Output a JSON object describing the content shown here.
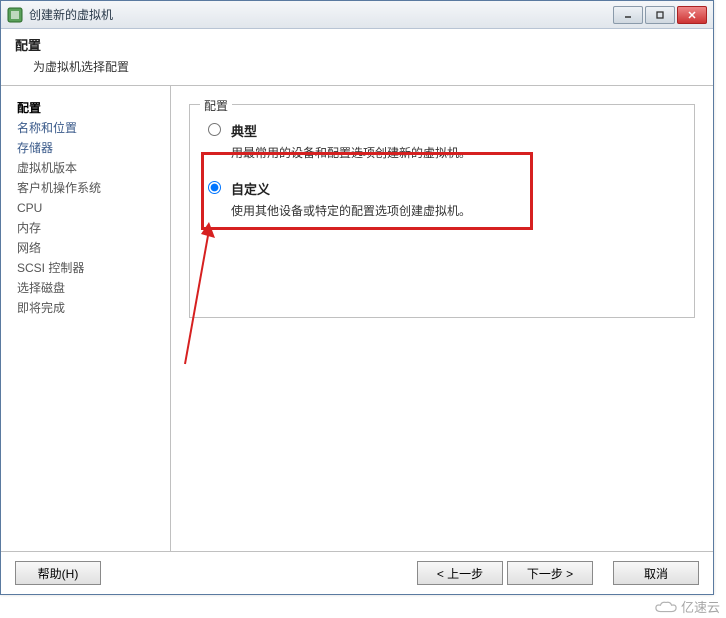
{
  "window": {
    "title": "创建新的虚拟机"
  },
  "header": {
    "title": "配置",
    "subtitle": "为虚拟机选择配置"
  },
  "sidebar": {
    "items": [
      {
        "label": "配置",
        "kind": "current"
      },
      {
        "label": "名称和位置",
        "kind": "link"
      },
      {
        "label": "存储器",
        "kind": "link"
      },
      {
        "label": "虚拟机版本",
        "kind": "text"
      },
      {
        "label": "客户机操作系统",
        "kind": "text"
      },
      {
        "label": "CPU",
        "kind": "text"
      },
      {
        "label": "内存",
        "kind": "text"
      },
      {
        "label": "网络",
        "kind": "text"
      },
      {
        "label": "SCSI 控制器",
        "kind": "text"
      },
      {
        "label": "选择磁盘",
        "kind": "text"
      },
      {
        "label": "即将完成",
        "kind": "text"
      }
    ]
  },
  "group": {
    "legend": "配置",
    "typical": {
      "label": "典型",
      "desc": "用最常用的设备和配置选项创建新的虚拟机。"
    },
    "custom": {
      "label": "自定义",
      "desc": "使用其他设备或特定的配置选项创建虚拟机。"
    },
    "selected": "custom"
  },
  "footer": {
    "help": "帮助(H)",
    "back": "< 上一步",
    "next": "下一步 >",
    "cancel": "取消"
  },
  "annotation": {
    "color": "#d62020"
  },
  "watermark": "亿速云"
}
